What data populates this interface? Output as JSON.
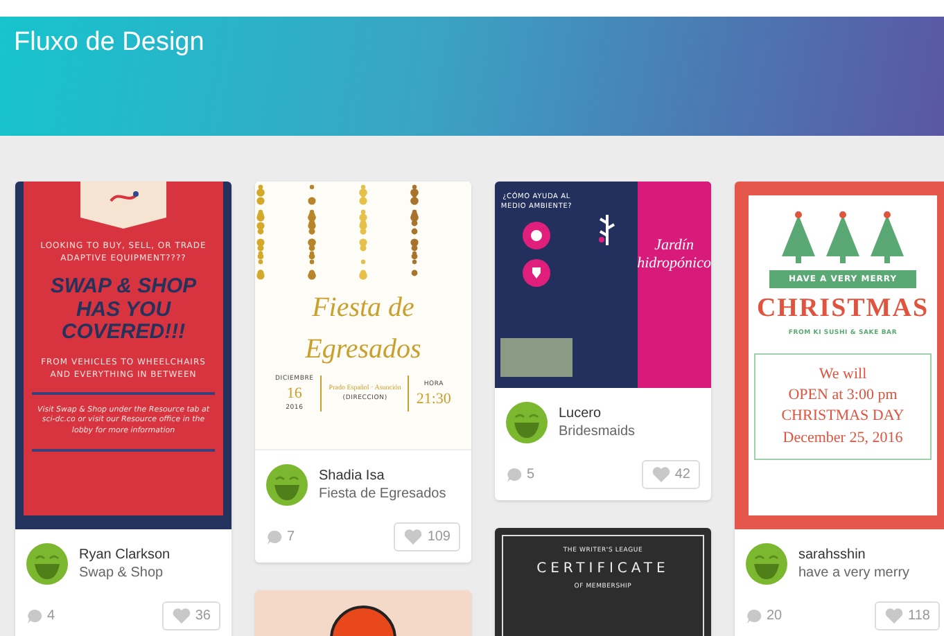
{
  "header": {
    "title": "Fluxo de Design"
  },
  "columns": [
    {
      "cards": [
        {
          "design": {
            "kind": "poster",
            "lines": [
              {
                "kind": "tiny",
                "text": "LOOKING TO BUY, SELL, OR TRADE ADAPTIVE EQUIPMENT????"
              },
              {
                "kind": "headline",
                "text": "SWAP & SHOP HAS YOU COVERED!!!"
              },
              {
                "kind": "tiny",
                "text": "FROM VEHICLES TO WHEELCHAIRS AND EVERYTHING IN BETWEEN"
              },
              {
                "kind": "note",
                "text": "Visit Swap & Shop under the Resource tab at sci-dc.co or visit our Resource office in the lobby for more information"
              }
            ]
          },
          "author": "Ryan Clarkson",
          "title": "Swap & Shop",
          "comments": "4",
          "likes": "36"
        }
      ]
    },
    {
      "cards": [
        {
          "design": {
            "kind": "invitation",
            "lines": [
              {
                "kind": "script",
                "text": "Fiesta de"
              },
              {
                "kind": "script",
                "text": "Egresados"
              },
              {
                "kind": "row",
                "columns": [
                  {
                    "lines": [
                      {
                        "kind": "micro",
                        "text": "DICIEMBRE"
                      },
                      {
                        "kind": "big",
                        "text": "16"
                      },
                      {
                        "kind": "micro",
                        "text": "2016"
                      }
                    ]
                  },
                  {
                    "lines": [
                      {
                        "kind": "gold",
                        "text": "Prado Español · Asunción"
                      },
                      {
                        "kind": "micro",
                        "text": "(DIRECCION)"
                      }
                    ]
                  },
                  {
                    "lines": [
                      {
                        "kind": "micro",
                        "text": "HORA"
                      },
                      {
                        "kind": "big",
                        "text": "21:30"
                      }
                    ]
                  }
                ]
              }
            ]
          },
          "author": "Shadia Isa",
          "title": "Fiesta de Egresados",
          "comments": "7",
          "likes": "109"
        },
        {
          "design": {
            "kind": "badge"
          }
        }
      ]
    },
    {
      "cards": [
        {
          "design": {
            "kind": "brochure",
            "lines": [
              {
                "kind": "heading",
                "text": "¿CÓMO AYUDA AL MEDIO AMBIENTE?"
              },
              {
                "kind": "script",
                "text": "Jardín hidropónico"
              }
            ]
          },
          "author": "Lucero",
          "title": "Bridesmaids",
          "comments": "5",
          "likes": "42"
        },
        {
          "design": {
            "kind": "certificate",
            "lines": [
              {
                "kind": "micro",
                "text": "THE WRITER'S LEAGUE"
              },
              {
                "kind": "title",
                "text": "CERTIFICATE"
              },
              {
                "kind": "micro",
                "text": "OF MEMBERSHIP"
              }
            ]
          }
        }
      ]
    },
    {
      "cards": [
        {
          "design": {
            "kind": "christmas",
            "lines": [
              {
                "kind": "ribbon",
                "text": "HAVE A VERY MERRY"
              },
              {
                "kind": "title",
                "text": "CHRISTMAS"
              },
              {
                "kind": "micro",
                "text": "FROM KI SUSHI & SAKE BAR"
              },
              {
                "kind": "box",
                "lines": [
                  {
                    "kind": "serif",
                    "text": "We will"
                  },
                  {
                    "kind": "serif",
                    "text": "OPEN at 3:00 pm"
                  },
                  {
                    "kind": "serif",
                    "text": "CHRISTMAS DAY"
                  },
                  {
                    "kind": "serif",
                    "text": "December 25, 2016"
                  }
                ]
              }
            ]
          },
          "author": "sarahsshin",
          "title": "have a very merry",
          "comments": "20",
          "likes": "118"
        }
      ]
    }
  ]
}
